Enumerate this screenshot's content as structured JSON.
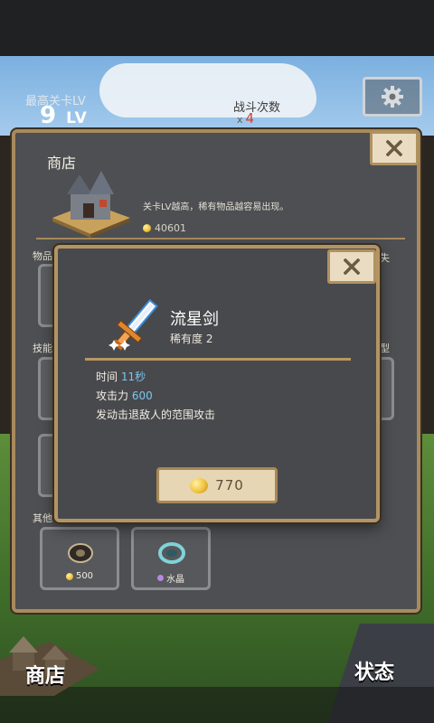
{
  "hud": {
    "stage_label": "最高关卡LV",
    "stage_value": "9",
    "stage_unit": "LV",
    "battle_label": "战斗次数",
    "battle_prefix": "x",
    "battle_value": "4",
    "settings_icon": "gear-icon"
  },
  "shop": {
    "title": "商店",
    "hint": "关卡LV越高，稀有物品越容易出现。",
    "coins": "40601",
    "sections": {
      "items": "物品",
      "skills": "技能",
      "other": "其他"
    },
    "right_edge_labels": [
      "失",
      "型"
    ],
    "slots": [
      {
        "icon": "disc-icon",
        "price": "500",
        "currency": "coin"
      },
      {
        "icon": "crystal-ring-icon",
        "price": "水晶",
        "currency": "crystal"
      }
    ]
  },
  "dialog": {
    "item_name": "流星剑",
    "rarity": "稀有度 2",
    "stats": [
      {
        "label": "时间 ",
        "value": "11秒"
      },
      {
        "label": "攻击力 ",
        "value": "600"
      },
      {
        "label": "发动击退敌人的范围攻击",
        "value": ""
      }
    ],
    "buy_price": "770"
  },
  "nav": {
    "shop": "商店",
    "status": "状态"
  },
  "colors": {
    "panel_border": "#a88a5d",
    "stat_value": "#79c6ee",
    "battle_count": "#d2402c"
  }
}
